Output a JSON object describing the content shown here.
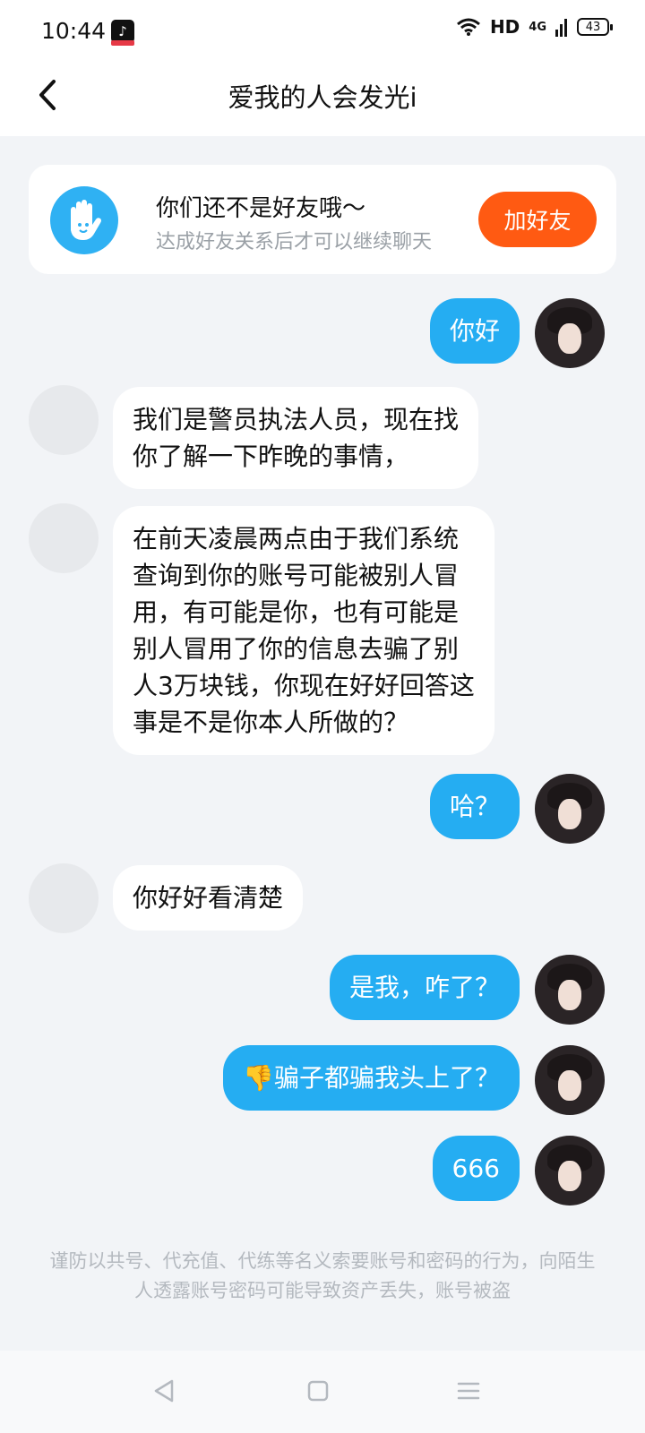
{
  "status_bar": {
    "time": "10:44",
    "network": "HD",
    "signal": "4G",
    "battery": "43"
  },
  "header": {
    "title": "爱我的人会发光i"
  },
  "friend_notice": {
    "title": "你们还不是好友哦～",
    "subtitle": "达成好友关系后才可以继续聊天",
    "add_button": "加好友"
  },
  "messages": [
    {
      "side": "right",
      "text": "你好"
    },
    {
      "side": "left",
      "text": "我们是警员执法人员，现在找\n你了解一下昨晚的事情，"
    },
    {
      "side": "left",
      "text": "在前天凌晨两点由于我们系统\n查询到你的账号可能被别人冒\n用，有可能是你，也有可能是\n别人冒用了你的信息去骗了别\n人3万块钱，你现在好好回答这\n事是不是你本人所做的？"
    },
    {
      "side": "right",
      "text": "哈？"
    },
    {
      "side": "left",
      "text": "你好好看清楚"
    },
    {
      "side": "right",
      "text": "是我，咋了？"
    },
    {
      "side": "right",
      "text": "👎骗子都骗我头上了？"
    },
    {
      "side": "right",
      "text": "666"
    }
  ],
  "footer_note": "谨防以共号、代充值、代练等名义索要账号和密码的行为，向陌生人透露账号密码可能导致资产丢失，账号被盗",
  "colors": {
    "accent": "#25adf2",
    "add_button": "#ff5a12"
  }
}
